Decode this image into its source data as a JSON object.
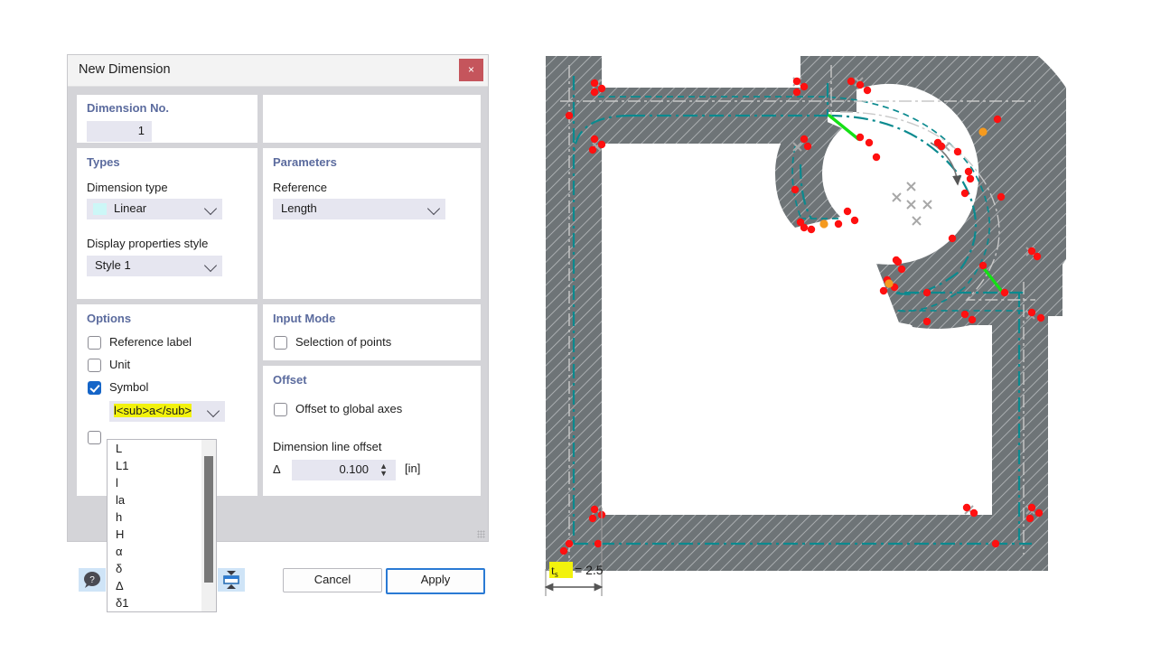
{
  "dialog": {
    "title": "New Dimension",
    "close_label": "×",
    "dimension_no": {
      "header": "Dimension No.",
      "value": "1"
    },
    "types": {
      "header": "Types",
      "dimension_type_label": "Dimension type",
      "dimension_type_value": "Linear",
      "display_style_label": "Display properties style",
      "display_style_value": "Style 1"
    },
    "parameters": {
      "header": "Parameters",
      "reference_label": "Reference",
      "reference_value": "Length"
    },
    "options": {
      "header": "Options",
      "reference_label_cb": "Reference label",
      "unit_cb": "Unit",
      "symbol_cb": "Symbol",
      "symbol_value": "l<sub>a</sub>",
      "symbol_options": [
        "L",
        "L1",
        "l",
        "la",
        "h",
        "H",
        "α",
        "δ",
        "Δ",
        "δ1"
      ]
    },
    "input_mode": {
      "header": "Input Mode",
      "selection_of_points": "Selection of points"
    },
    "offset": {
      "header": "Offset",
      "offset_global_axes": "Offset to global axes",
      "dim_line_offset_label": "Dimension line offset",
      "delta_symbol": "Δ",
      "offset_value": "0.100",
      "unit": "[in]"
    },
    "footer": {
      "help_icon": "help-icon",
      "center_icon": "align-center-icon",
      "cancel": "Cancel",
      "apply": "Apply"
    }
  },
  "cad": {
    "dimension_symbol": "t",
    "dimension_sub": "s",
    "dimension_eq": "= 2.5"
  },
  "colors": {
    "accent": "#5b6b9e",
    "close_red": "#c5555c",
    "primary_border": "#2a7ad4",
    "field_bg": "#e6e6f0",
    "checkbox_on": "#1565c8",
    "highlight": "#f2f20d",
    "hatch_fill": "#6e7477",
    "centerline": "#0b8a8f",
    "node_red": "#ff1010",
    "node_orange": "#f59a1e",
    "support_green": "#16e016"
  }
}
